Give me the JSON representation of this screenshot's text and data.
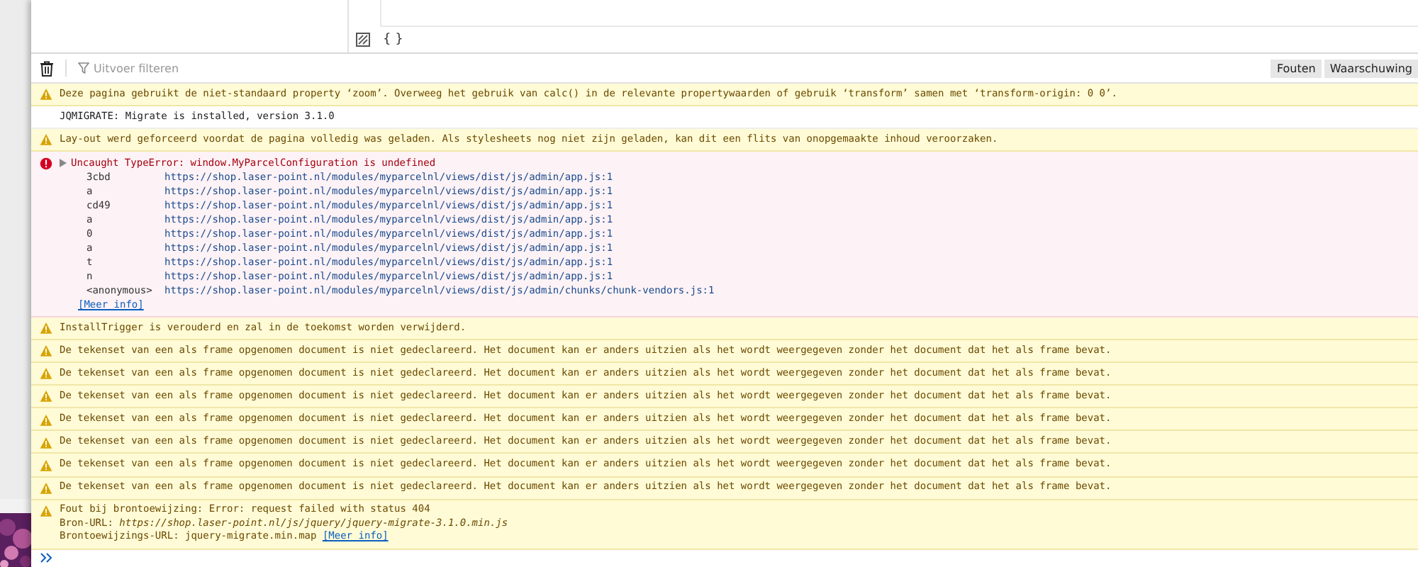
{
  "editor": {
    "pretty_print_label": "{ }"
  },
  "toolbar": {
    "filter_placeholder": "Uitvoer filteren",
    "filters": [
      {
        "label": "Fouten",
        "selected": true
      },
      {
        "label": "Waarschuwing",
        "selected": true
      }
    ]
  },
  "messages": [
    {
      "kind": "warning",
      "lines": [
        "Deze pagina gebruikt de niet-standaard property ‘zoom’. Overweeg het gebruik van calc() in de relevante propertywaarden of gebruik ‘transform’ samen met ‘transform-origin: 0 0’."
      ]
    },
    {
      "kind": "log",
      "lines": [
        "JQMIGRATE: Migrate is installed, version 3.1.0"
      ]
    },
    {
      "kind": "warning",
      "lines": [
        "Lay-out werd geforceerd voordat de pagina volledig was geladen. Als stylesheets nog niet zijn geladen, kan dit een flits van onopgemaakte inhoud veroorzaken."
      ]
    },
    {
      "kind": "error",
      "lines": [
        "Uncaught TypeError: window.MyParcelConfiguration is undefined"
      ],
      "expanded": true,
      "more_info": "[Meer info]",
      "stack": [
        {
          "fn": "3cbd",
          "url": "https://shop.laser-point.nl/modules/myparcelnl/views/dist/js/admin/app.js:1"
        },
        {
          "fn": "a",
          "url": "https://shop.laser-point.nl/modules/myparcelnl/views/dist/js/admin/app.js:1"
        },
        {
          "fn": "cd49",
          "url": "https://shop.laser-point.nl/modules/myparcelnl/views/dist/js/admin/app.js:1"
        },
        {
          "fn": "a",
          "url": "https://shop.laser-point.nl/modules/myparcelnl/views/dist/js/admin/app.js:1"
        },
        {
          "fn": "0",
          "url": "https://shop.laser-point.nl/modules/myparcelnl/views/dist/js/admin/app.js:1"
        },
        {
          "fn": "a",
          "url": "https://shop.laser-point.nl/modules/myparcelnl/views/dist/js/admin/app.js:1"
        },
        {
          "fn": "t",
          "url": "https://shop.laser-point.nl/modules/myparcelnl/views/dist/js/admin/app.js:1"
        },
        {
          "fn": "n",
          "url": "https://shop.laser-point.nl/modules/myparcelnl/views/dist/js/admin/app.js:1"
        },
        {
          "fn": "<anonymous>",
          "url": "https://shop.laser-point.nl/modules/myparcelnl/views/dist/js/admin/chunks/chunk-vendors.js:1"
        }
      ]
    },
    {
      "kind": "warning",
      "lines": [
        "InstallTrigger is verouderd en zal in de toekomst worden verwijderd."
      ]
    },
    {
      "kind": "warning",
      "lines": [
        "De tekenset van een als frame opgenomen document is niet gedeclareerd. Het document kan er anders uitzien als het wordt weergegeven zonder het document dat het als frame bevat."
      ]
    },
    {
      "kind": "warning",
      "lines": [
        "De tekenset van een als frame opgenomen document is niet gedeclareerd. Het document kan er anders uitzien als het wordt weergegeven zonder het document dat het als frame bevat."
      ]
    },
    {
      "kind": "warning",
      "lines": [
        "De tekenset van een als frame opgenomen document is niet gedeclareerd. Het document kan er anders uitzien als het wordt weergegeven zonder het document dat het als frame bevat."
      ]
    },
    {
      "kind": "warning",
      "lines": [
        "De tekenset van een als frame opgenomen document is niet gedeclareerd. Het document kan er anders uitzien als het wordt weergegeven zonder het document dat het als frame bevat."
      ]
    },
    {
      "kind": "warning",
      "lines": [
        "De tekenset van een als frame opgenomen document is niet gedeclareerd. Het document kan er anders uitzien als het wordt weergegeven zonder het document dat het als frame bevat."
      ]
    },
    {
      "kind": "warning",
      "lines": [
        "De tekenset van een als frame opgenomen document is niet gedeclareerd. Het document kan er anders uitzien als het wordt weergegeven zonder het document dat het als frame bevat."
      ]
    },
    {
      "kind": "warning",
      "lines": [
        "De tekenset van een als frame opgenomen document is niet gedeclareerd. Het document kan er anders uitzien als het wordt weergegeven zonder het document dat het als frame bevat."
      ]
    },
    {
      "kind": "warning",
      "lines": [
        "Fout bij brontoewijzing: Error: request failed with status 404",
        "Bron-URL: *https://shop.laser-point.nl/js/jquery/jquery-migrate-3.1.0.min.js*",
        "Brontoewijzings-URL: jquery-migrate.min.map"
      ],
      "more_info": "[Meer info]"
    }
  ]
}
